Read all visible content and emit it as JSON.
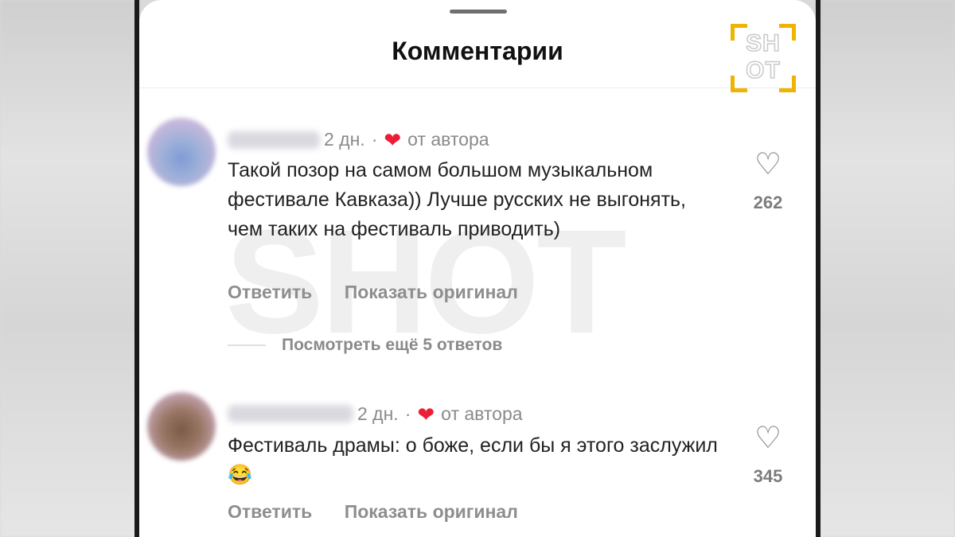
{
  "header": {
    "title": "Комментарии"
  },
  "watermark": "SHOT",
  "logo": {
    "text_top": "SH",
    "text_bottom": "OT",
    "accent": "#f0b400"
  },
  "icons": {
    "like": "heart-outline-icon",
    "author_like": "heart-filled-icon",
    "emoji": "face-with-tears-of-joy"
  },
  "colors": {
    "author_heart": "#ee1d36",
    "secondary_text": "#8a8a8a"
  },
  "comments": [
    {
      "time": "2 дн.",
      "separator": "·",
      "author_liked": "от автора",
      "text": "Такой позор на самом большом музыкальном фестивале Кавказа)) Лучше русских не выгонять, чем таких на фестиваль приводить)",
      "likes": "262",
      "reply_label": "Ответить",
      "show_original_label": "Показать оригинал",
      "view_replies": "Посмотреть ещё 5 ответов"
    },
    {
      "time": "2 дн.",
      "separator": "·",
      "author_liked": "от автора",
      "text": "Фестиваль драмы: о боже, если бы я этого заслужил",
      "emoji": "😂",
      "likes": "345",
      "reply_label": "Ответить",
      "show_original_label": "Показать оригинал"
    }
  ]
}
